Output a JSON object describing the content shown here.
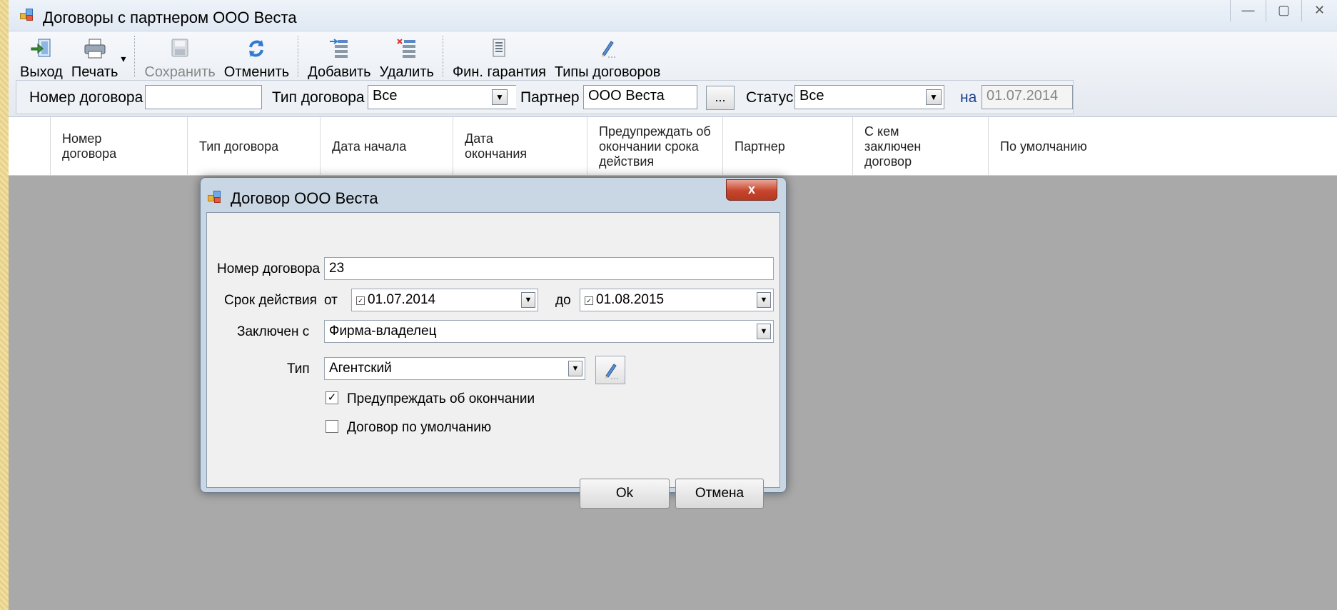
{
  "window": {
    "title": "Договоры с партнером  ООО Веста",
    "controls": [
      "—",
      "▢",
      "✕"
    ]
  },
  "toolbar": {
    "buttons": [
      {
        "label": "Выход",
        "icon": "exit-icon"
      },
      {
        "label": "Печать",
        "icon": "printer-icon"
      },
      {
        "label": "Сохранить",
        "icon": "save-icon"
      },
      {
        "label": "Отменить",
        "icon": "undo-icon"
      },
      {
        "label": "Добавить",
        "icon": "add-row-icon"
      },
      {
        "label": "Удалить",
        "icon": "delete-row-icon"
      },
      {
        "label": "Фин. гарантия",
        "icon": "document-icon"
      },
      {
        "label": "Типы договоров",
        "icon": "edit-pencil-icon"
      }
    ],
    "print_dropdown_glyph": "▾"
  },
  "filters": {
    "contract_number_label": "Номер договора",
    "contract_number_value": "",
    "contract_type_label": "Тип договора",
    "contract_type_value": "Все",
    "partner_label": "Партнер",
    "partner_value": "ООО Веста",
    "partner_browse": "...",
    "status_label": "Статус",
    "status_value": "Все",
    "date_label": "на",
    "date_value": "01.07.2014"
  },
  "grid": {
    "columns": [
      [
        "Номер",
        "договора"
      ],
      [
        "Тип договора"
      ],
      [
        "Дата начала"
      ],
      [
        "Дата",
        "окончания"
      ],
      [
        "Предупреждать об",
        "окончании срока",
        "действия"
      ],
      [
        "Партнер"
      ],
      [
        "С кем",
        "заключен",
        "договор"
      ],
      [
        "По умолчанию"
      ]
    ]
  },
  "dialog": {
    "title": "Договор ООО Веста",
    "close": "x",
    "number_label": "Номер договора",
    "number_value": "23",
    "term_label": "Срок действия",
    "from_label": "от",
    "from_value": "01.07.2014",
    "from_checked": "✓",
    "to_label": "до",
    "to_value": "01.08.2015",
    "to_checked": "✓",
    "concluded_label": "Заключен с",
    "concluded_value": "Фирма-владелец",
    "type_label": "Тип",
    "type_value": "Агентский",
    "warn_label": "Предупреждать об окончании",
    "warn_checked": "✓",
    "default_label": "Договор по умолчанию",
    "default_checked": "",
    "ok_label": "Ok",
    "cancel_label": "Отмена"
  }
}
